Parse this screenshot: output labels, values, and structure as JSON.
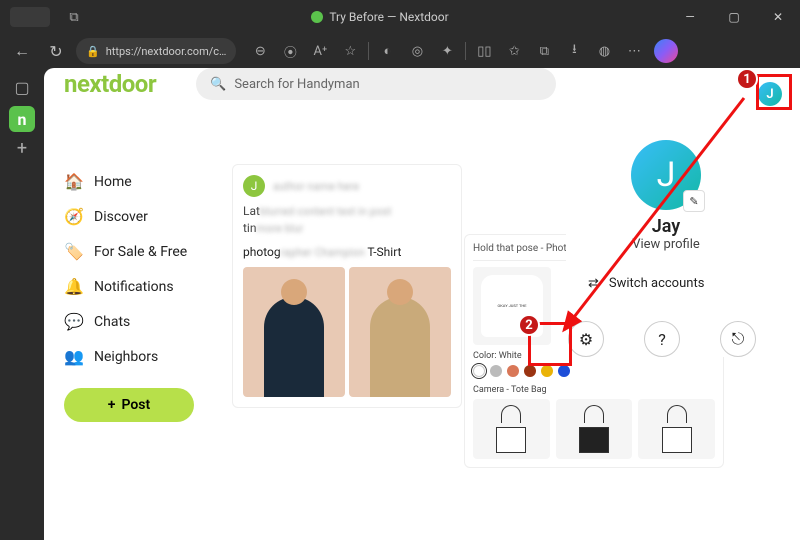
{
  "window": {
    "title": "Try Before — Nextdoor",
    "url": "https://nextdoor.com/c…"
  },
  "brand": "nextdoor",
  "search": {
    "placeholder": "Search for Handyman"
  },
  "nav": {
    "items": [
      {
        "label": "Home"
      },
      {
        "label": "Discover"
      },
      {
        "label": "For Sale & Free"
      },
      {
        "label": "Notifications"
      },
      {
        "label": "Chats"
      },
      {
        "label": "Neighbors"
      }
    ],
    "post": "Post"
  },
  "feed": {
    "author_initial": "J",
    "body_prefix": "Lat",
    "body_mid": "tin",
    "title_prefix": "photog",
    "title_suffix": "T-Shirt"
  },
  "shop": {
    "tab": "Hold that pose - Photograp",
    "shirt_lines": "OKAY\nJUST\nTHE",
    "color_label": "Color: White",
    "swatches": [
      "#ffffff",
      "#bbbbbb",
      "#d97757",
      "#9a3412",
      "#eab308",
      "#1d4ed8"
    ],
    "prod2": "Camera - Tote Bag"
  },
  "menu": {
    "avatar_initial": "J",
    "name": "Jay",
    "view_profile": "View profile",
    "switch": "Switch accounts"
  },
  "anno": {
    "n1": "1",
    "n2": "2"
  }
}
